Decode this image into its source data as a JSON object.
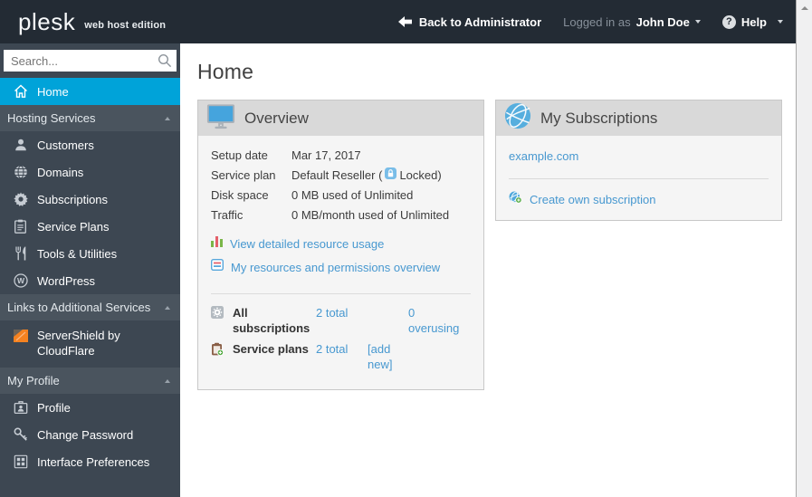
{
  "colors": {
    "accent": "#00a3d9",
    "link": "#4798d0",
    "topbar_bg": "#232b34",
    "sidebar_bg": "#3d4752",
    "card_header_bg": "#d9d9d9"
  },
  "topbar": {
    "logo_text": "plesk",
    "logo_suffix": "web host edition",
    "back_label": "Back to Administrator",
    "logged_in_prefix": "Logged in as",
    "user_name": "John Doe",
    "help_glyph": "?",
    "help_label": "Help"
  },
  "sidebar": {
    "search_placeholder": "Search...",
    "home": {
      "label": "Home",
      "icon": "home-icon"
    },
    "sections": [
      {
        "label": "Hosting Services",
        "items": [
          {
            "label": "Customers",
            "icon": "person-icon"
          },
          {
            "label": "Domains",
            "icon": "globe-icon"
          },
          {
            "label": "Subscriptions",
            "icon": "gear-icon"
          },
          {
            "label": "Service Plans",
            "icon": "clipboard-icon"
          },
          {
            "label": "Tools & Utilities",
            "icon": "utensils-icon"
          },
          {
            "label": "WordPress",
            "icon": "wordpress-icon"
          }
        ]
      },
      {
        "label": "Links to Additional Services",
        "items": [
          {
            "label": "ServerShield by CloudFlare",
            "icon": "servershield-icon"
          }
        ]
      },
      {
        "label": "My Profile",
        "items": [
          {
            "label": "Profile",
            "icon": "badge-icon"
          },
          {
            "label": "Change Password",
            "icon": "key-icon"
          },
          {
            "label": "Interface Preferences",
            "icon": "grid-icon"
          }
        ]
      }
    ]
  },
  "main": {
    "page_title": "Home",
    "overview": {
      "title": "Overview",
      "icon": "monitor-icon",
      "details": [
        {
          "label": "Setup date",
          "value": "Mar 17, 2017"
        },
        {
          "label": "Service plan",
          "value": "Default Reseller (",
          "locked_suffix": "Locked)",
          "lock_icon": "lock-icon"
        },
        {
          "label": "Disk space",
          "value": "0 MB used of Unlimited"
        },
        {
          "label": "Traffic",
          "value": "0 MB/month used of Unlimited"
        }
      ],
      "links": [
        {
          "label": "View detailed resource usage",
          "icon": "bar-chart-icon"
        },
        {
          "label": "My resources and permissions overview",
          "icon": "resources-list-icon"
        }
      ],
      "totals": [
        {
          "label": "All subscriptions",
          "icon": "gear-badge-icon",
          "count": "2 total",
          "overusing": "0 overusing"
        },
        {
          "label": "Service plans",
          "icon": "clipboard-plus-icon",
          "count": "2 total",
          "add_new": "[add new]"
        }
      ]
    },
    "subscriptions": {
      "title": "My Subscriptions",
      "icon": "globe-icon",
      "domain": "example.com",
      "create_label": "Create own subscription",
      "create_icon": "globe-plus-icon"
    }
  }
}
